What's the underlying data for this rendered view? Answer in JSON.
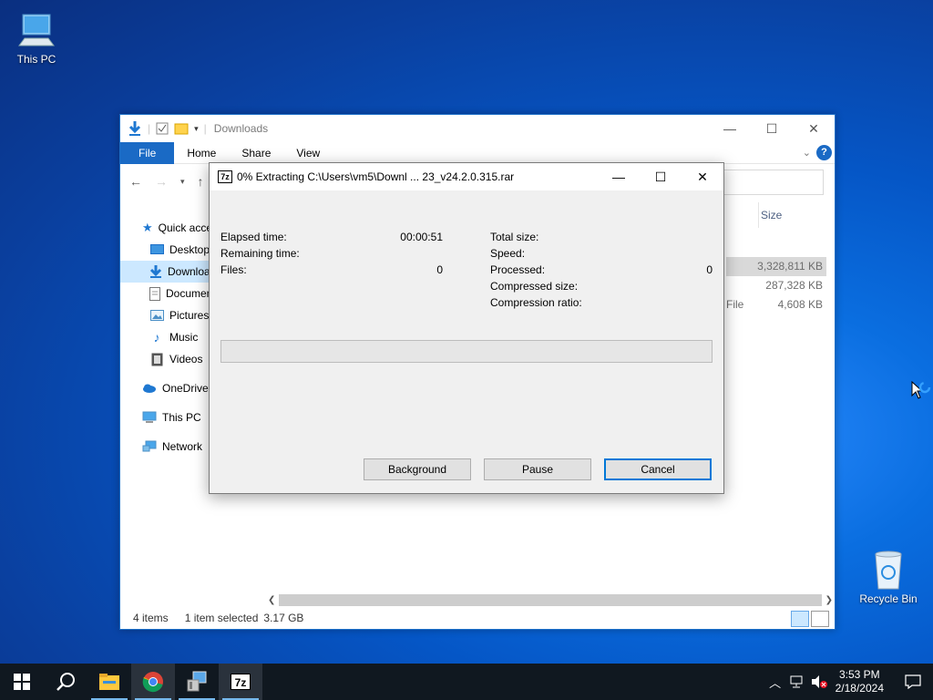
{
  "desktop": {
    "this_pc_label": "This PC",
    "recycle_bin_label": "Recycle Bin"
  },
  "explorer": {
    "title": "Downloads",
    "ribbon_tabs": [
      "File",
      "Home",
      "Share",
      "View"
    ],
    "column_size": "Size",
    "sidebar": [
      {
        "label": "Quick access",
        "icon": "star-icon"
      },
      {
        "label": "Desktop",
        "icon": "desktop-folder-icon"
      },
      {
        "label": "Downloads",
        "icon": "download-folder-icon"
      },
      {
        "label": "Documents",
        "icon": "documents-folder-icon"
      },
      {
        "label": "Pictures",
        "icon": "pictures-folder-icon"
      },
      {
        "label": "Music",
        "icon": "music-folder-icon"
      },
      {
        "label": "Videos",
        "icon": "videos-folder-icon"
      },
      {
        "label": "OneDrive",
        "icon": "onedrive-icon"
      },
      {
        "label": "This PC",
        "icon": "this-pc-icon"
      },
      {
        "label": "Network",
        "icon": "network-icon"
      }
    ],
    "files": [
      {
        "type": "",
        "size": "3,328,811 KB"
      },
      {
        "type": "",
        "size": "287,328 KB"
      },
      {
        "type": "File",
        "size": "4,608 KB"
      }
    ],
    "status": {
      "items": "4 items",
      "selected": "1 item selected",
      "size": "3.17 GB"
    }
  },
  "dialog": {
    "app_icon_text": "7z",
    "title": "0% Extracting C:\\Users\\vm5\\Downl ... 23_v24.2.0.315.rar",
    "left": {
      "elapsed_label": "Elapsed time:",
      "elapsed_value": "00:00:51",
      "remaining_label": "Remaining time:",
      "remaining_value": "",
      "files_label": "Files:",
      "files_value": "0"
    },
    "right": {
      "total_label": "Total size:",
      "total_value": "",
      "speed_label": "Speed:",
      "speed_value": "",
      "processed_label": "Processed:",
      "processed_value": "0",
      "compressed_label": "Compressed size:",
      "compressed_value": "",
      "ratio_label": "Compression ratio:",
      "ratio_value": ""
    },
    "progress_percent": 0,
    "buttons": {
      "background": "Background",
      "pause": "Pause",
      "cancel": "Cancel"
    }
  },
  "taskbar": {
    "apps": [
      "start-icon",
      "search-icon",
      "file-explorer-icon",
      "chrome-icon",
      "installer-icon",
      "7zip-icon"
    ],
    "time": "3:53 PM",
    "date": "2/18/2024",
    "taskbar_7zip_text": "7z"
  },
  "colors": {
    "accent": "#0078d7",
    "ribbon_file": "#1a6ac5",
    "taskbar": "#101820"
  }
}
